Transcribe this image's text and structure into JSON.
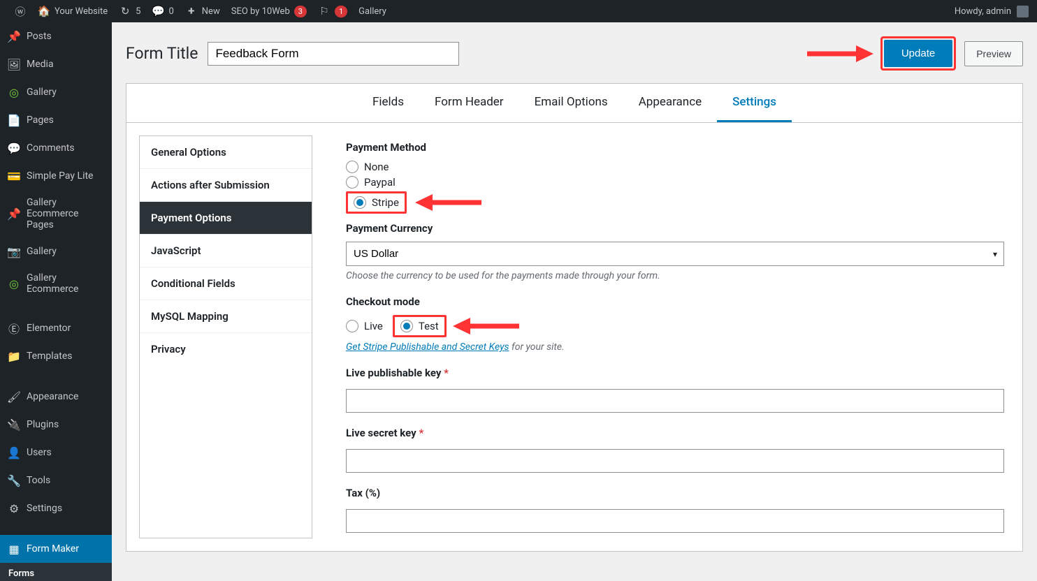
{
  "adminbar": {
    "site_name": "Your Website",
    "updates_count": "5",
    "comments_count": "0",
    "new_label": "New",
    "seo_label": "SEO by 10Web",
    "seo_count": "3",
    "notif_count": "1",
    "gallery_label": "Gallery",
    "howdy": "Howdy, admin"
  },
  "sidebar": {
    "items": [
      {
        "icon": "📌",
        "label": "Posts"
      },
      {
        "icon": "🖼",
        "label": "Media"
      },
      {
        "icon": "◎",
        "label": "Gallery",
        "green": true
      },
      {
        "icon": "📄",
        "label": "Pages"
      },
      {
        "icon": "💬",
        "label": "Comments"
      },
      {
        "icon": "💳",
        "label": "Simple Pay Lite"
      },
      {
        "icon": "📌",
        "label": "Gallery Ecommerce Pages"
      },
      {
        "icon": "📷",
        "label": "Gallery",
        "green": true
      },
      {
        "icon": "◎",
        "label": "Gallery Ecommerce",
        "green": true
      }
    ],
    "items2": [
      {
        "icon": "Ⓔ",
        "label": "Elementor"
      },
      {
        "icon": "📁",
        "label": "Templates"
      }
    ],
    "items3": [
      {
        "icon": "🖌",
        "label": "Appearance"
      },
      {
        "icon": "🔌",
        "label": "Plugins"
      },
      {
        "icon": "👤",
        "label": "Users"
      },
      {
        "icon": "🔧",
        "label": "Tools"
      },
      {
        "icon": "⚙",
        "label": "Settings"
      }
    ],
    "current": {
      "icon": "▦",
      "label": "Form Maker"
    },
    "sub": {
      "label": "Forms"
    }
  },
  "header": {
    "form_title_label": "Form Title",
    "form_title_value": "Feedback Form",
    "update_label": "Update",
    "preview_label": "Preview"
  },
  "tabs": [
    "Fields",
    "Form Header",
    "Email Options",
    "Appearance",
    "Settings"
  ],
  "active_tab": "Settings",
  "side_nav": [
    "General Options",
    "Actions after Submission",
    "Payment Options",
    "JavaScript",
    "Conditional Fields",
    "MySQL Mapping",
    "Privacy"
  ],
  "side_nav_selected": "Payment Options",
  "settings": {
    "payment_method_label": "Payment Method",
    "pm_none": "None",
    "pm_paypal": "Paypal",
    "pm_stripe": "Stripe",
    "currency_label": "Payment Currency",
    "currency_value": "US Dollar",
    "currency_help": "Choose the currency to be used for the payments made through your form.",
    "checkout_label": "Checkout mode",
    "cm_live": "Live",
    "cm_test": "Test",
    "keys_link": "Get Stripe Publishable and Secret Keys",
    "keys_suffix": " for your site.",
    "live_pub_label": "Live publishable key",
    "live_sec_label": "Live secret key",
    "tax_label": "Tax (%)"
  }
}
